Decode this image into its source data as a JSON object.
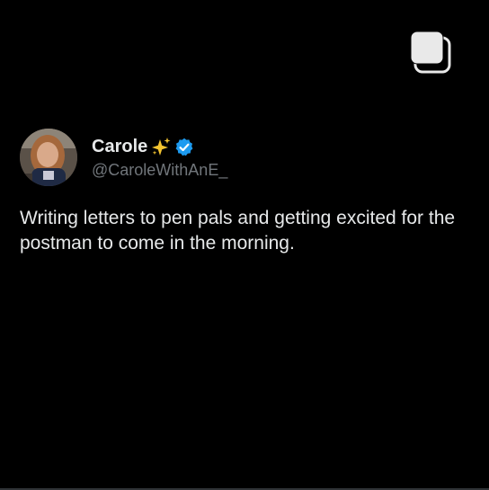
{
  "post": {
    "author": {
      "display_name": "Carole",
      "name_emoji_icon": "sparkles-icon",
      "verified_icon": "verified-badge-icon",
      "handle": "@CaroleWithAnE_"
    },
    "text": "Writing letters to pen pals and getting excited for the postman to come in the morning."
  },
  "toolbar": {
    "icon": "stacked-pages-icon"
  },
  "colors": {
    "background": "#000000",
    "primary_text": "#e7e9ea",
    "secondary_text": "#71767b",
    "verified_blue": "#1d9bf0",
    "sparkle_gold": "#f4c430"
  }
}
